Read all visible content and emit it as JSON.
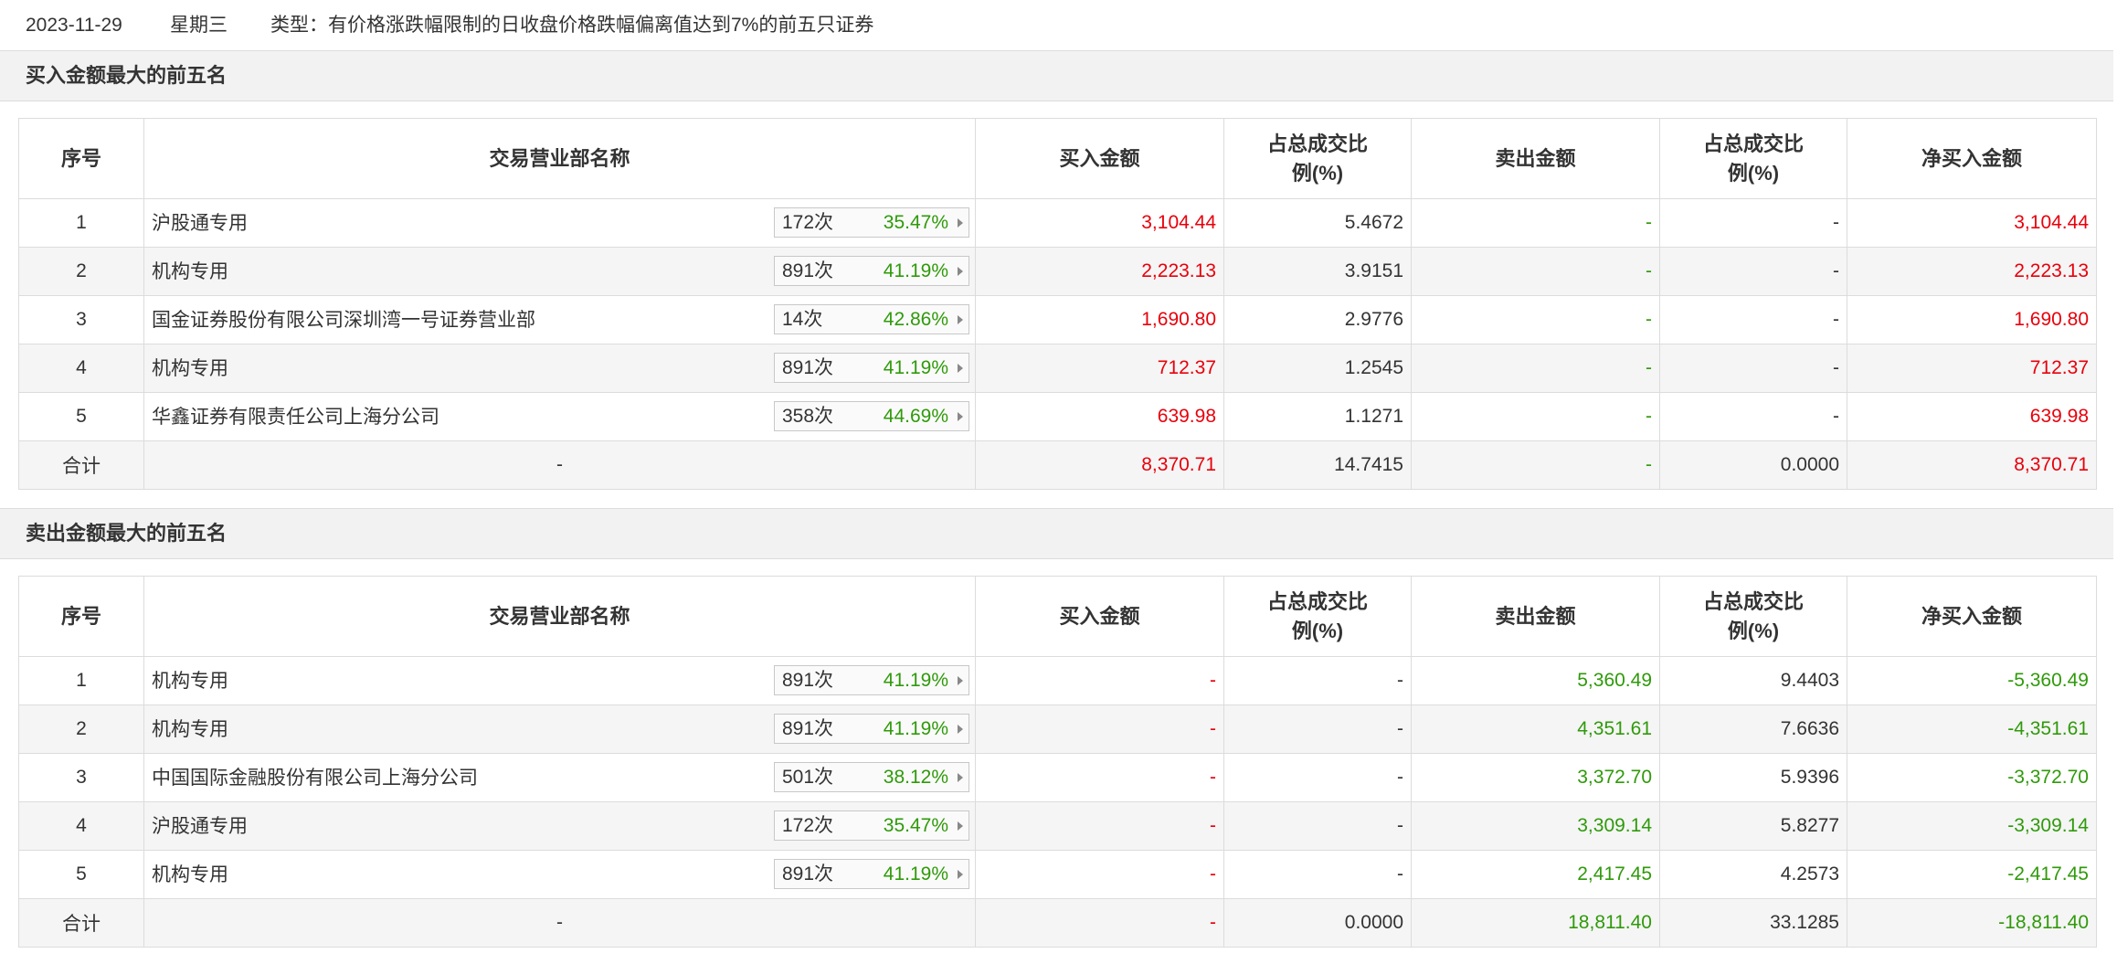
{
  "header": {
    "date": "2023-11-29",
    "weekday": "星期三",
    "type_text": "类型：有价格涨跌幅限制的日收盘价格跌幅偏离值达到7%的前五只证券"
  },
  "buy_section": {
    "title": "买入金额最大的前五名",
    "columns": [
      "序号",
      "交易营业部名称",
      "买入金额",
      "占总成交比例(%)",
      "卖出金额",
      "占总成交比例(%)",
      "净买入金额"
    ],
    "rows": [
      {
        "rank": "1",
        "name": "沪股通专用",
        "count": "172次",
        "pct": "35.47%",
        "buy": "3,104.44",
        "buy_ratio": "5.4672",
        "sell": "-",
        "sell_ratio": "-",
        "net": "3,104.44"
      },
      {
        "rank": "2",
        "name": "机构专用",
        "count": "891次",
        "pct": "41.19%",
        "buy": "2,223.13",
        "buy_ratio": "3.9151",
        "sell": "-",
        "sell_ratio": "-",
        "net": "2,223.13"
      },
      {
        "rank": "3",
        "name": "国金证券股份有限公司深圳湾一号证券营业部",
        "count": "14次",
        "pct": "42.86%",
        "buy": "1,690.80",
        "buy_ratio": "2.9776",
        "sell": "-",
        "sell_ratio": "-",
        "net": "1,690.80"
      },
      {
        "rank": "4",
        "name": "机构专用",
        "count": "891次",
        "pct": "41.19%",
        "buy": "712.37",
        "buy_ratio": "1.2545",
        "sell": "-",
        "sell_ratio": "-",
        "net": "712.37"
      },
      {
        "rank": "5",
        "name": "华鑫证券有限责任公司上海分公司",
        "count": "358次",
        "pct": "44.69%",
        "buy": "639.98",
        "buy_ratio": "1.1271",
        "sell": "-",
        "sell_ratio": "-",
        "net": "639.98"
      }
    ],
    "total": {
      "label": "合计",
      "name": "-",
      "buy": "8,370.71",
      "buy_ratio": "14.7415",
      "sell": "-",
      "sell_ratio": "0.0000",
      "net": "8,370.71"
    }
  },
  "sell_section": {
    "title": "卖出金额最大的前五名",
    "columns": [
      "序号",
      "交易营业部名称",
      "买入金额",
      "占总成交比例(%)",
      "卖出金额",
      "占总成交比例(%)",
      "净买入金额"
    ],
    "rows": [
      {
        "rank": "1",
        "name": "机构专用",
        "count": "891次",
        "pct": "41.19%",
        "buy": "-",
        "buy_ratio": "-",
        "sell": "5,360.49",
        "sell_ratio": "9.4403",
        "net": "-5,360.49"
      },
      {
        "rank": "2",
        "name": "机构专用",
        "count": "891次",
        "pct": "41.19%",
        "buy": "-",
        "buy_ratio": "-",
        "sell": "4,351.61",
        "sell_ratio": "7.6636",
        "net": "-4,351.61"
      },
      {
        "rank": "3",
        "name": "中国国际金融股份有限公司上海分公司",
        "count": "501次",
        "pct": "38.12%",
        "buy": "-",
        "buy_ratio": "-",
        "sell": "3,372.70",
        "sell_ratio": "5.9396",
        "net": "-3,372.70"
      },
      {
        "rank": "4",
        "name": "沪股通专用",
        "count": "172次",
        "pct": "35.47%",
        "buy": "-",
        "buy_ratio": "-",
        "sell": "3,309.14",
        "sell_ratio": "5.8277",
        "net": "-3,309.14"
      },
      {
        "rank": "5",
        "name": "机构专用",
        "count": "891次",
        "pct": "41.19%",
        "buy": "-",
        "buy_ratio": "-",
        "sell": "2,417.45",
        "sell_ratio": "4.2573",
        "net": "-2,417.45"
      }
    ],
    "total": {
      "label": "合计",
      "name": "-",
      "buy": "-",
      "buy_ratio": "0.0000",
      "sell": "18,811.40",
      "sell_ratio": "33.1285",
      "net": "-18,811.40"
    }
  },
  "colors": {
    "positive": "#e8000b",
    "negative": "#2f9a0a",
    "header_bg": "#f2f2f2",
    "stripe_bg": "#f5f5f5"
  }
}
